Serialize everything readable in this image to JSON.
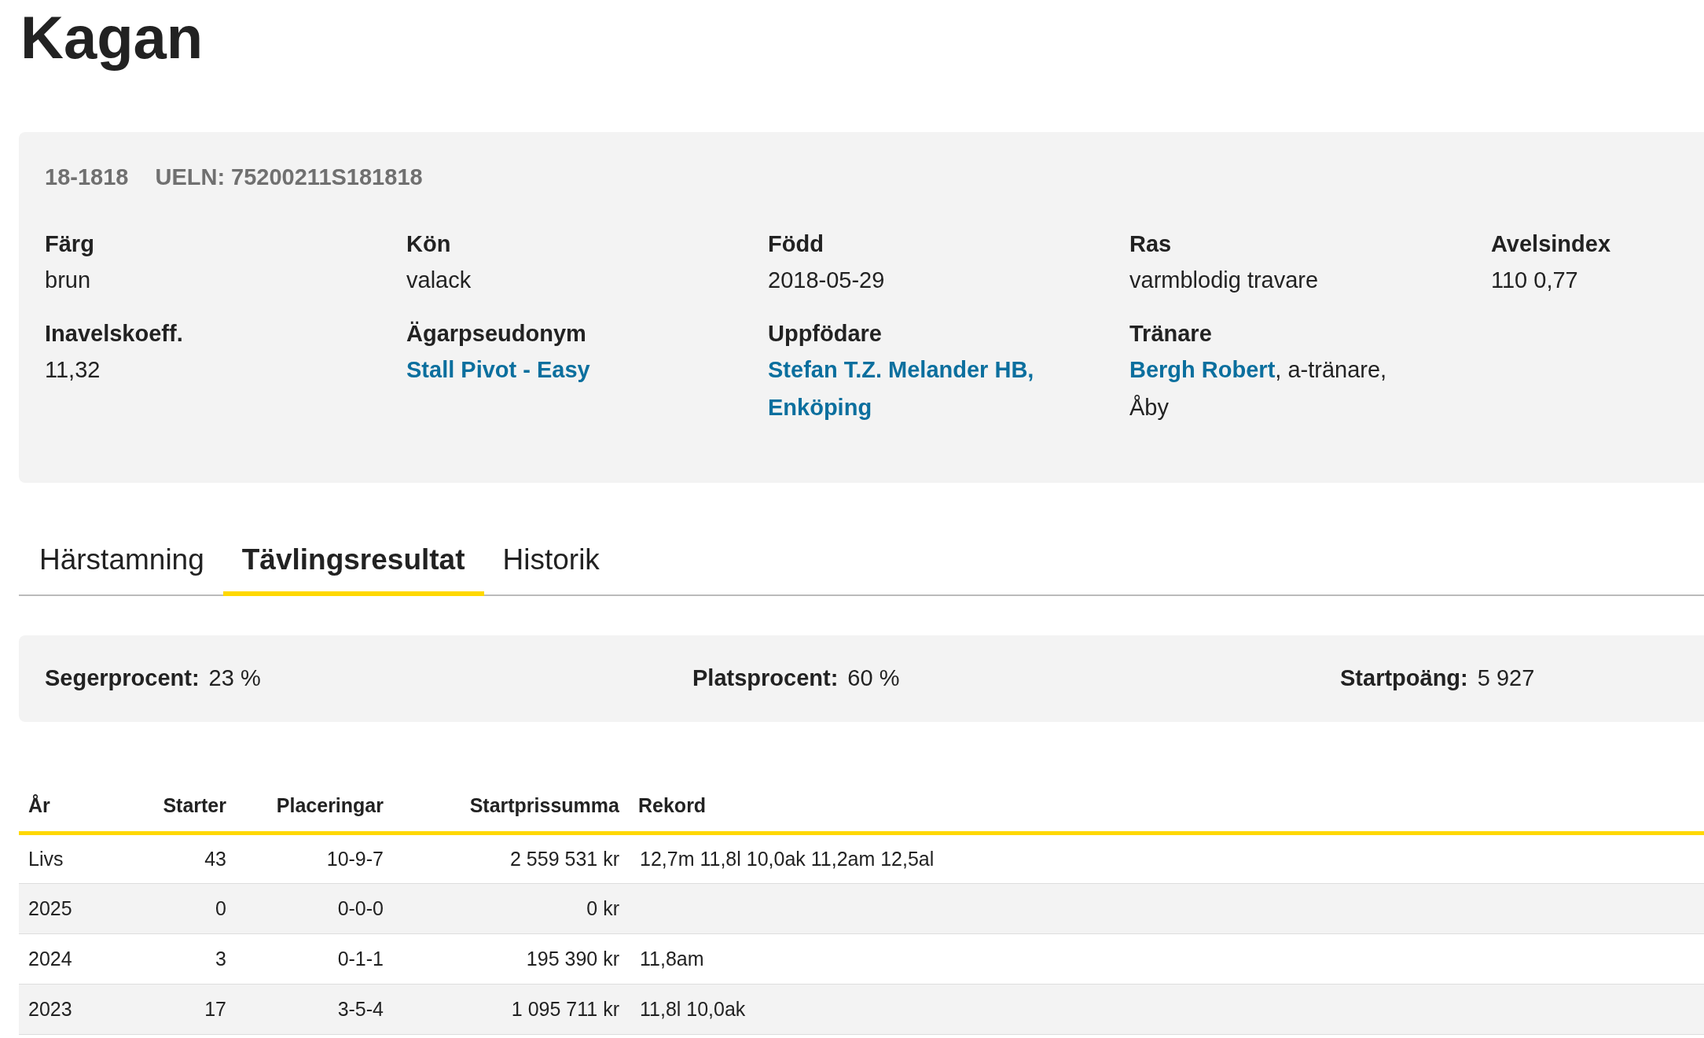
{
  "title": "Kagan",
  "info": {
    "ids": [
      "18-1818",
      "UELN: 75200211S181818"
    ],
    "fields": [
      {
        "label": "Färg",
        "parts": [
          {
            "text": "brun",
            "link": false
          }
        ]
      },
      {
        "label": "Kön",
        "parts": [
          {
            "text": "valack",
            "link": false
          }
        ]
      },
      {
        "label": "Född",
        "parts": [
          {
            "text": "2018-05-29",
            "link": false
          }
        ]
      },
      {
        "label": "Ras",
        "parts": [
          {
            "text": "varmblodig travare",
            "link": false
          }
        ]
      },
      {
        "label": "Avelsindex",
        "parts": [
          {
            "text": "110 0,77",
            "link": false
          }
        ]
      },
      {
        "label": "Inavelskoeff.",
        "parts": [
          {
            "text": "11,32",
            "link": false
          }
        ]
      },
      {
        "label": "Ägarpseudonym",
        "parts": [
          {
            "text": "Stall Pivot - Easy",
            "link": true
          }
        ]
      },
      {
        "label": "Uppfödare",
        "parts": [
          {
            "text": "Stefan T.Z. Melander HB, Enköping",
            "link": true
          }
        ]
      },
      {
        "label": "Tränare",
        "parts": [
          {
            "text": "Bergh Robert",
            "link": true
          },
          {
            "text": ", a-tränare, Åby",
            "link": false
          }
        ]
      }
    ]
  },
  "tabs": [
    {
      "label": "Härstamning",
      "selected": false
    },
    {
      "label": "Tävlingsresultat",
      "selected": true
    },
    {
      "label": "Historik",
      "selected": false
    }
  ],
  "stats": [
    {
      "label": "Segerprocent:",
      "value": "23 %"
    },
    {
      "label": "Platsprocent:",
      "value": "60 %"
    },
    {
      "label": "Startpoäng:",
      "value": "5 927"
    }
  ],
  "table": {
    "columns": [
      "År",
      "Starter",
      "Placeringar",
      "Startprissumma",
      "Rekord"
    ],
    "rows": [
      [
        "Livs",
        "43",
        "10-9-7",
        "2 559 531 kr",
        "12,7m 11,8l 10,0ak 11,2am 12,5al"
      ],
      [
        "2025",
        "0",
        "0-0-0",
        "0 kr",
        ""
      ],
      [
        "2024",
        "3",
        "0-1-1",
        "195 390 kr",
        "11,8am"
      ],
      [
        "2023",
        "17",
        "3-5-4",
        "1 095 711 kr",
        "11,8l 10,0ak"
      ]
    ]
  }
}
